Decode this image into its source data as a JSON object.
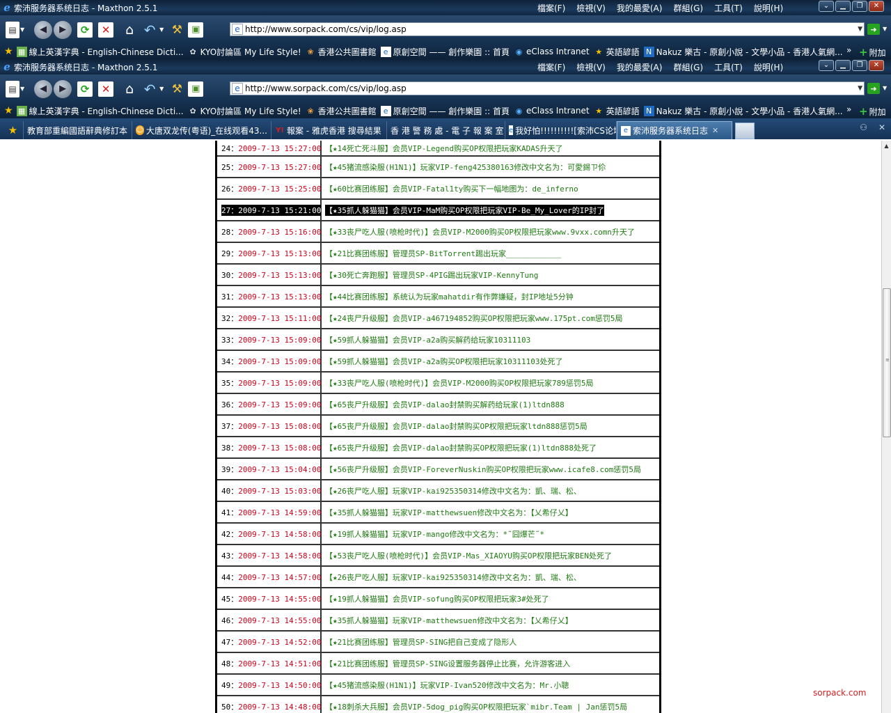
{
  "window": {
    "title": "索沛服务器系统日志 - Maxthon 2.5.1",
    "menu": [
      "檔案(F)",
      "檢視(V)",
      "我的最愛(A)",
      "群組(G)",
      "工具(T)",
      "說明(H)"
    ]
  },
  "address": {
    "url": "http://www.sorpack.com/cs/vip/log.asp"
  },
  "favorites": [
    {
      "label": "線上英漢字典 - English-Chinese Dicti...",
      "icon": "dictionary-icon"
    },
    {
      "label": "KYO討論區 My Life Style!",
      "icon": "forum-icon"
    },
    {
      "label": "香港公共圖書館",
      "icon": "library-icon"
    },
    {
      "label": "原創空間 —— 創作樂園 :: 首頁",
      "icon": "page-icon"
    },
    {
      "label": "eClass Intranet",
      "icon": "globe-icon"
    },
    {
      "label": "英語諺語",
      "icon": "star-icon"
    },
    {
      "label": "Nakuz 樂古 - 原創小說 - 文學小品 - 香港人氣網...",
      "icon": "nakuz-icon"
    }
  ],
  "favorites_more": "»",
  "favorites_add": "附加",
  "tabs": [
    {
      "label": "教育部重編國語辭典修訂本",
      "icon": "none",
      "active": false
    },
    {
      "label": "大唐双龙传(粤语)_在线观看43...",
      "icon": "smiley-icon",
      "active": false
    },
    {
      "label": "報案 - 雅虎香港 搜尋結果",
      "icon": "yahoo-icon",
      "active": false
    },
    {
      "label": "香 港 警 務 處 - 電 子 報 案 室",
      "icon": "none",
      "active": false
    },
    {
      "label": "我好怕!!!!!!!!!![索沛CS论坛]",
      "icon": "page-icon",
      "active": false
    },
    {
      "label": "索沛服务器系统日志",
      "icon": "page-icon",
      "active": true
    }
  ],
  "log": [
    {
      "num": "24",
      "time": "2009-7-13 15:27:00",
      "msg": "【★14死亡死斗服】会员VIP-Legend购买OP权限把玩家KADAS升天了"
    },
    {
      "num": "25",
      "time": "2009-7-13 15:27:00",
      "msg": "【★45猪流感染服(H1N1)】玩家VIP-feng425380163修改中文名为：可愛錫ㄗ伱"
    },
    {
      "num": "26",
      "time": "2009-7-13 15:25:00",
      "msg": "【★60比赛团练服】会员VIP-Fatal1ty购买下一幅地图为：de_inferno"
    },
    {
      "num": "27",
      "time": "2009-7-13 15:21:00",
      "msg": "【★35抓人躲猫猫】会员VIP-MaM购买OP权限把玩家VIP-Be_My_Lover的IP封了",
      "selected": true
    },
    {
      "num": "28",
      "time": "2009-7-13 15:16:00",
      "msg": "【★33丧尸吃人服(喷枪时代)】会员VIP-M2000购买OP权限把玩家www.9vxx.comn升天了"
    },
    {
      "num": "29",
      "time": "2009-7-13 15:13:00",
      "msg": "【★21比赛团练服】管理员SP-BitTorrent踢出玩家____________"
    },
    {
      "num": "30",
      "time": "2009-7-13 15:13:00",
      "msg": "【★30死亡奔跑服】管理员SP-4PIG踢出玩家VIP-KennyTung"
    },
    {
      "num": "31",
      "time": "2009-7-13 15:13:00",
      "msg": "【★44比赛团练服】系统认为玩家mahatdir有作弊嫌疑，封IP地址5分钟"
    },
    {
      "num": "32",
      "time": "2009-7-13 15:11:00",
      "msg": "【★24丧尸升级服】会员VIP-a467194852购买OP权限把玩家www.175pt.com惩罚5局"
    },
    {
      "num": "33",
      "time": "2009-7-13 15:09:00",
      "msg": "【★59抓人躲猫猫】会员VIP-a2a购买解药给玩家10311103"
    },
    {
      "num": "34",
      "time": "2009-7-13 15:09:00",
      "msg": "【★59抓人躲猫猫】会员VIP-a2a购买OP权限把玩家10311103处死了"
    },
    {
      "num": "35",
      "time": "2009-7-13 15:09:00",
      "msg": "【★33丧尸吃人服(喷枪时代)】会员VIP-M2000购买OP权限把玩家789惩罚5局"
    },
    {
      "num": "36",
      "time": "2009-7-13 15:09:00",
      "msg": "【★65丧尸升级服】会员VIP-dalao封禁购买解药给玩家(1)ltdn888"
    },
    {
      "num": "37",
      "time": "2009-7-13 15:08:00",
      "msg": "【★65丧尸升级服】会员VIP-dalao封禁购买OP权限把玩家ltdn888惩罚5局"
    },
    {
      "num": "38",
      "time": "2009-7-13 15:08:00",
      "msg": "【★65丧尸升级服】会员VIP-dalao封禁购买OP权限把玩家(1)ltdn888处死了"
    },
    {
      "num": "39",
      "time": "2009-7-13 15:04:00",
      "msg": "【★56丧尸升级服】会员VIP-ForeverNuskin购买OP权限把玩家www.icafe8.com惩罚5局"
    },
    {
      "num": "40",
      "time": "2009-7-13 15:03:00",
      "msg": "【★26丧尸吃人服】玩家VIP-kai925350314修改中文名为：凱、瑞、松、"
    },
    {
      "num": "41",
      "time": "2009-7-13 14:59:00",
      "msg": "【★35抓人躲猫猫】玩家VIP-matthewsuen修改中文名为：【乂希仔乂】"
    },
    {
      "num": "42",
      "time": "2009-7-13 14:58:00",
      "msg": "【★19抓人躲猫猫】玩家VIP-mango修改中文名为：*˜囧爆芒˜*"
    },
    {
      "num": "43",
      "time": "2009-7-13 14:58:00",
      "msg": "【★53丧尸吃人服(喷枪时代)】会员VIP-Mas_XIAOYU购买OP权限把玩家BEN处死了"
    },
    {
      "num": "44",
      "time": "2009-7-13 14:57:00",
      "msg": "【★26丧尸吃人服】玩家VIP-kai925350314修改中文名为：凱、瑞、松、"
    },
    {
      "num": "45",
      "time": "2009-7-13 14:55:00",
      "msg": "【★19抓人躲猫猫】会员VIP-sofung购买OP权限把玩家3#处死了"
    },
    {
      "num": "46",
      "time": "2009-7-13 14:55:00",
      "msg": "【★35抓人躲猫猫】玩家VIP-matthewsuen修改中文名为：【乂希仔乂】"
    },
    {
      "num": "47",
      "time": "2009-7-13 14:52:00",
      "msg": "【★21比赛团练服】管理员SP-SING把自己变成了隐形人"
    },
    {
      "num": "48",
      "time": "2009-7-13 14:51:00",
      "msg": "【★21比赛团练服】管理员SP-SING设置服务器停止比赛，允许游客进入"
    },
    {
      "num": "49",
      "time": "2009-7-13 14:50:00",
      "msg": "【★45猪流感染服(H1N1)】玩家VIP-Ivan520修改中文名为：Mr.小聰"
    },
    {
      "num": "50",
      "time": "2009-7-13 14:48:00",
      "msg": "【★18刺杀大兵服】会员VIP-5dog_pig购买OP权限把玩家`mibr.Team | Jan惩罚5局"
    }
  ],
  "watermark": "sorpack.com"
}
